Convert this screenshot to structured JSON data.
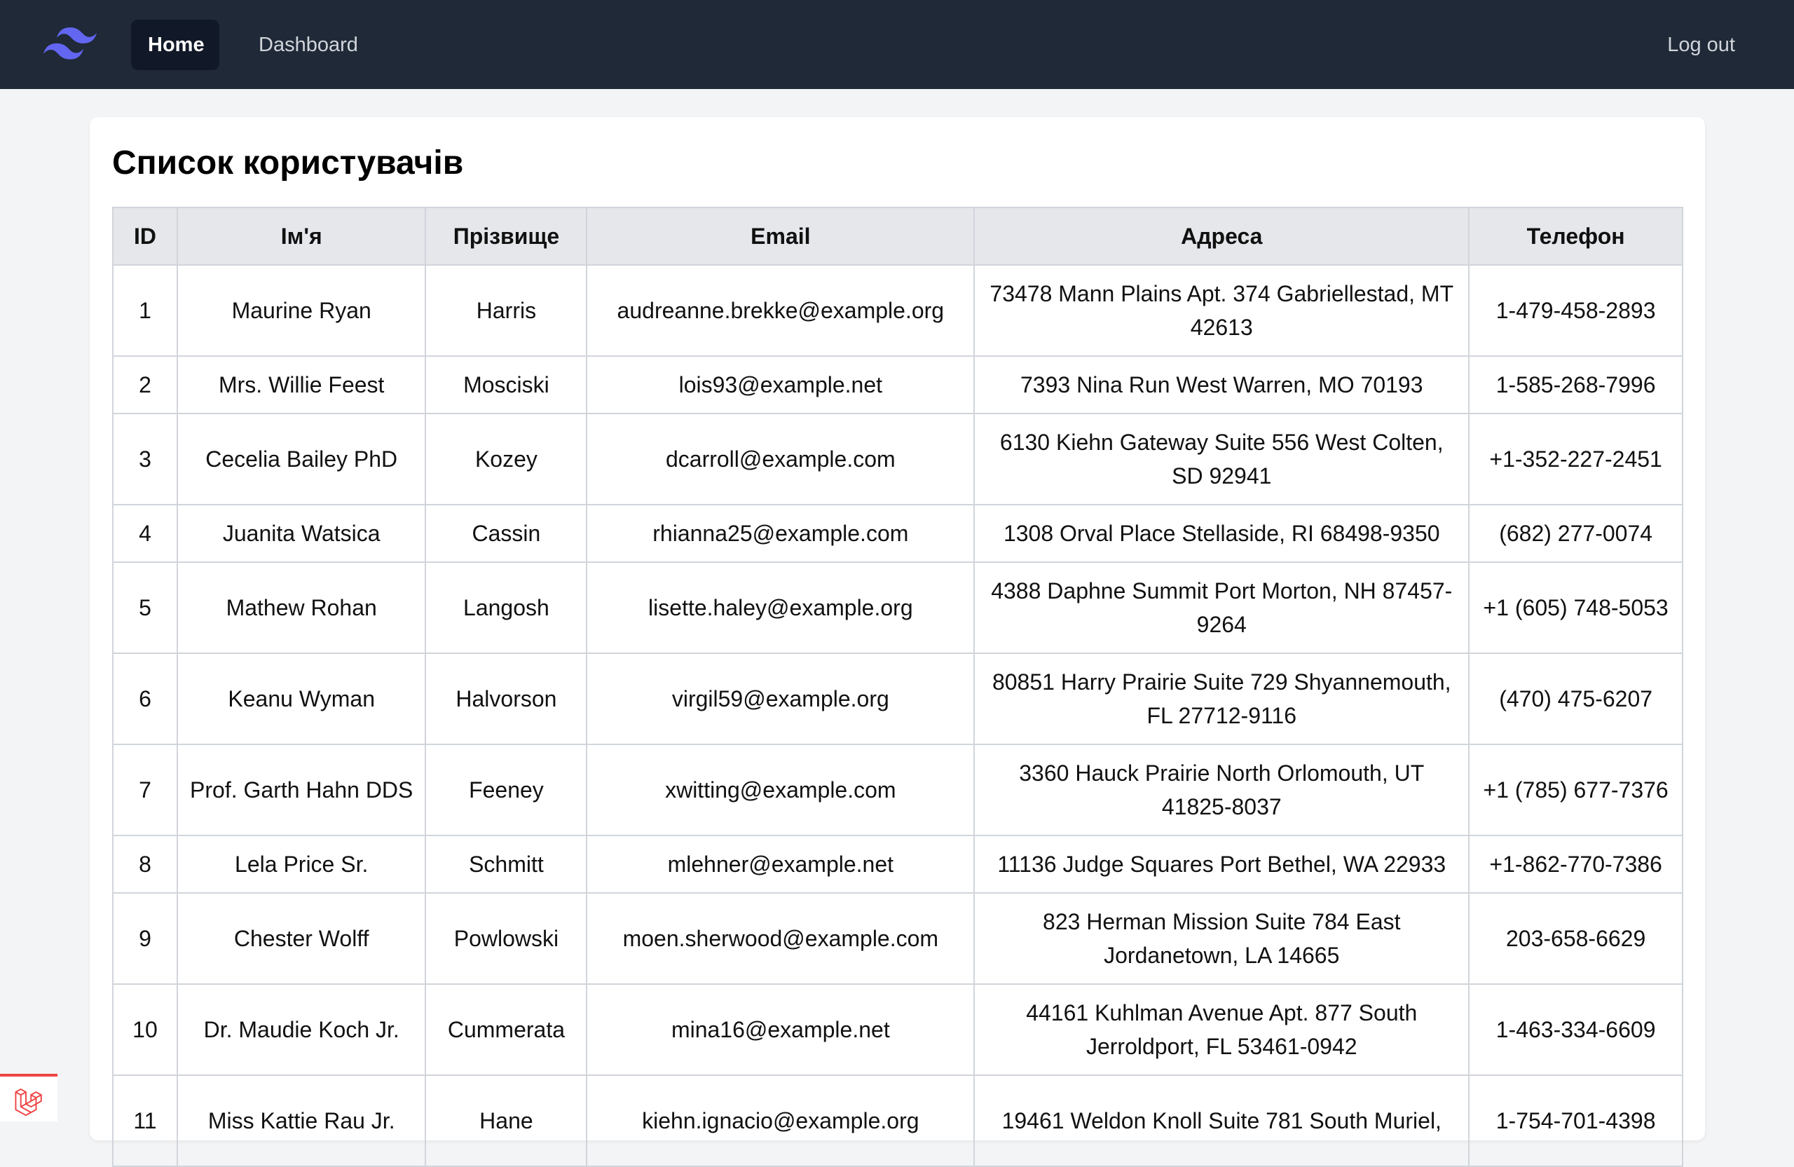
{
  "nav": {
    "logo_icon": "tailwind-logo-icon",
    "home_label": "Home",
    "dashboard_label": "Dashboard",
    "logout_label": "Log out"
  },
  "page": {
    "title": "Список користувачів"
  },
  "table": {
    "headers": {
      "id": "ID",
      "first_name": "Ім'я",
      "last_name": "Прізвище",
      "email": "Email",
      "address": "Адреса",
      "phone": "Телефон"
    },
    "rows": [
      {
        "id": "1",
        "first_name": "Maurine Ryan",
        "last_name": "Harris",
        "email": "audreanne.brekke@example.org",
        "address": "73478 Mann Plains Apt. 374 Gabriellestad, MT 42613",
        "phone": "1-479-458-2893"
      },
      {
        "id": "2",
        "first_name": "Mrs. Willie Feest",
        "last_name": "Mosciski",
        "email": "lois93@example.net",
        "address": "7393 Nina Run West Warren, MO 70193",
        "phone": "1-585-268-7996"
      },
      {
        "id": "3",
        "first_name": "Cecelia Bailey PhD",
        "last_name": "Kozey",
        "email": "dcarroll@example.com",
        "address": "6130 Kiehn Gateway Suite 556 West Colten, SD 92941",
        "phone": "+1-352-227-2451"
      },
      {
        "id": "4",
        "first_name": "Juanita Watsica",
        "last_name": "Cassin",
        "email": "rhianna25@example.com",
        "address": "1308 Orval Place Stellaside, RI 68498-9350",
        "phone": "(682) 277-0074"
      },
      {
        "id": "5",
        "first_name": "Mathew Rohan",
        "last_name": "Langosh",
        "email": "lisette.haley@example.org",
        "address": "4388 Daphne Summit Port Morton, NH 87457-9264",
        "phone": "+1 (605) 748-5053"
      },
      {
        "id": "6",
        "first_name": "Keanu Wyman",
        "last_name": "Halvorson",
        "email": "virgil59@example.org",
        "address": "80851 Harry Prairie Suite 729 Shyannemouth, FL 27712-9116",
        "phone": "(470) 475-6207"
      },
      {
        "id": "7",
        "first_name": "Prof. Garth Hahn DDS",
        "last_name": "Feeney",
        "email": "xwitting@example.com",
        "address": "3360 Hauck Prairie North Orlomouth, UT 41825-8037",
        "phone": "+1 (785) 677-7376"
      },
      {
        "id": "8",
        "first_name": "Lela Price Sr.",
        "last_name": "Schmitt",
        "email": "mlehner@example.net",
        "address": "11136 Judge Squares Port Bethel, WA 22933",
        "phone": "+1-862-770-7386"
      },
      {
        "id": "9",
        "first_name": "Chester Wolff",
        "last_name": "Powlowski",
        "email": "moen.sherwood@example.com",
        "address": "823 Herman Mission Suite 784 East Jordanetown, LA 14665",
        "phone": "203-658-6629"
      },
      {
        "id": "10",
        "first_name": "Dr. Maudie Koch Jr.",
        "last_name": "Cummerata",
        "email": "mina16@example.net",
        "address": "44161 Kuhlman Avenue Apt. 877 South Jerroldport, FL 53461-0942",
        "phone": "1-463-334-6609"
      },
      {
        "id": "11",
        "first_name": "Miss Kattie Rau Jr.",
        "last_name": "Hane",
        "email": "kiehn.ignacio@example.org",
        "address": "19461 Weldon Knoll Suite 781 South Muriel,",
        "phone": "1-754-701-4398"
      }
    ]
  },
  "debug_badge": {
    "icon": "laravel-logo-icon",
    "accent_color": "#ef4444"
  }
}
